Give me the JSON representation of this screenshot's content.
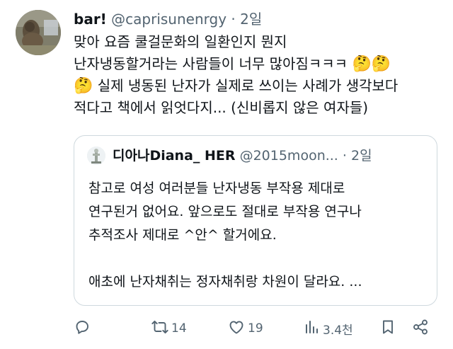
{
  "tweet": {
    "display_name": "bar!",
    "handle": "@caprisunenrgy",
    "separator": " · ",
    "time": "2일",
    "text_line1": "맞아 요즘 쿨걸문화의 일환인지 뭔지",
    "text_line2a": "난자냉동할거라는 사람들이 너무 많아짐ㅋㅋㅋ ",
    "text_emoji": "🤔🤔",
    "text_line3_emoji": "🤔",
    "text_line3": " 실제 냉동된 난자가 실제로 쓰이는 사례가 생각보다",
    "text_line4": "적다고 책에서 읽엇다지... (신비롭지 않은 여자들)"
  },
  "quote": {
    "display_name": "디아나Diana_ HER",
    "handle": "@2015moon...",
    "separator": " · ",
    "time": "2일",
    "text": "참고로 여성 여러분들 난자냉동 부작용 제대로\n연구된거 없어요. 앞으로도 절대로 부작용 연구나\n추적조사 제대로 ^안^ 할거에요.\n\n애초에 난자채취는 정자채취랑 차원이 달라요. ..."
  },
  "actions": {
    "reply_icon": "reply-icon",
    "retweet_count": "14",
    "like_count": "19",
    "views_count": "3.4천",
    "bookmark_icon": "bookmark-icon",
    "share_icon": "share-icon"
  },
  "colors": {
    "text": "#0f1419",
    "secondary": "#536471",
    "border": "#cfd9de"
  }
}
